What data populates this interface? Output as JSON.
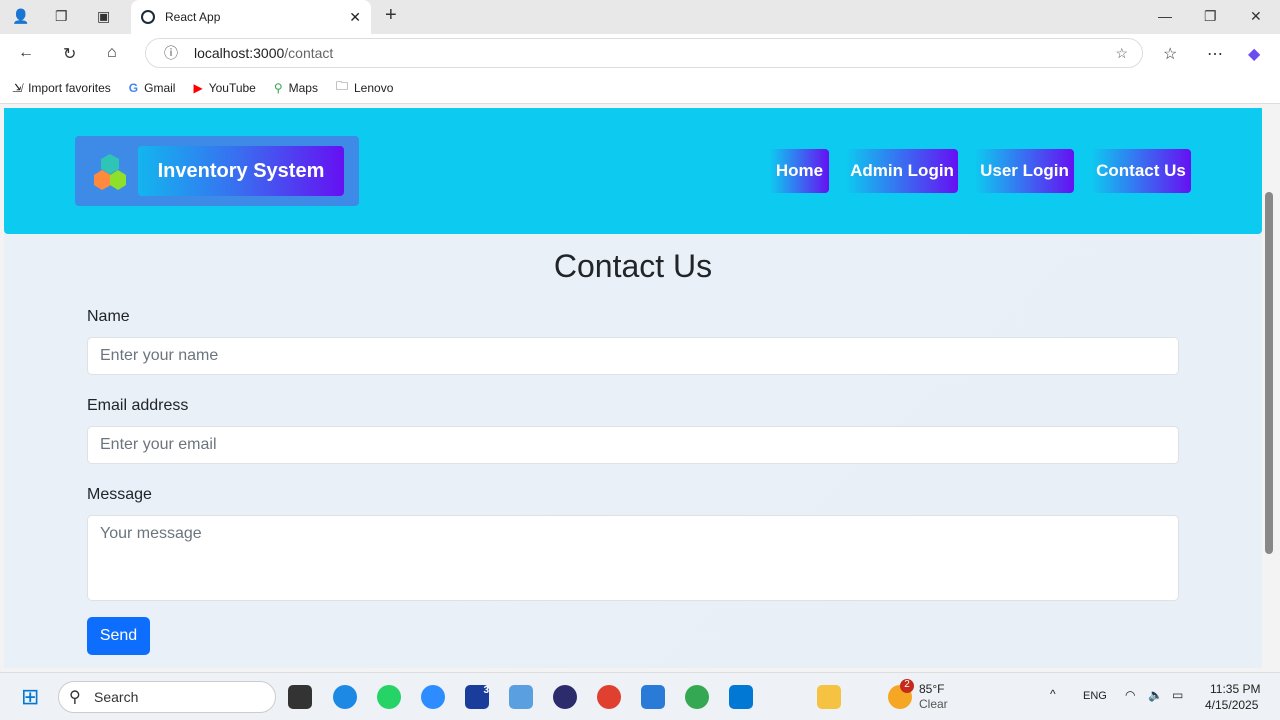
{
  "browser": {
    "tab_title": "React App",
    "url_host": "localhost:3000",
    "url_path": "/contact",
    "bookmarks": [
      "Import favorites",
      "Gmail",
      "YouTube",
      "Maps",
      "Lenovo"
    ]
  },
  "header": {
    "brand": "Inventory System",
    "nav": [
      "Home",
      "Admin Login",
      "User Login",
      "Contact Us"
    ]
  },
  "main": {
    "title": "Contact Us",
    "fields": [
      {
        "label": "Name",
        "placeholder": "Enter your name"
      },
      {
        "label": "Email address",
        "placeholder": "Enter your email"
      },
      {
        "label": "Message",
        "placeholder": "Your message"
      }
    ],
    "send": "Send"
  },
  "taskbar": {
    "search": "Search",
    "weather_temp": "85°F",
    "weather_desc": "Clear",
    "weather_badge": "2",
    "lang": "ENG",
    "time": "11:35 PM",
    "date": "4/15/2025",
    "badge_l": "3"
  },
  "colors": {
    "header": "#0dcaf0",
    "gradient_end": "#6610f2",
    "send": "#0d6efd"
  }
}
